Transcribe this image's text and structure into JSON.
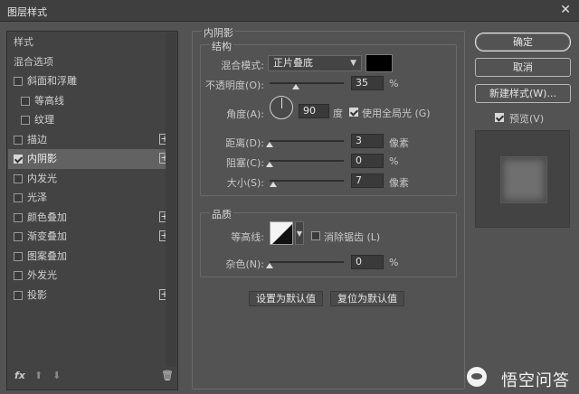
{
  "window": {
    "title": "图层样式",
    "close_glyph": "✕"
  },
  "left_panel": {
    "items": [
      {
        "label": "样式",
        "type": "header"
      },
      {
        "label": "混合选项",
        "type": "header"
      },
      {
        "label": "斜面和浮雕",
        "checked": false
      },
      {
        "label": "等高线",
        "checked": false,
        "sub": true
      },
      {
        "label": "纹理",
        "checked": false,
        "sub": true
      },
      {
        "label": "描边",
        "checked": false,
        "plus": "+"
      },
      {
        "label": "内阴影",
        "checked": true,
        "plus": "+",
        "selected": true
      },
      {
        "label": "内发光",
        "checked": false
      },
      {
        "label": "光泽",
        "checked": false
      },
      {
        "label": "颜色叠加",
        "checked": false,
        "plus": "+"
      },
      {
        "label": "渐变叠加",
        "checked": false,
        "plus": "+"
      },
      {
        "label": "图案叠加",
        "checked": false
      },
      {
        "label": "外发光",
        "checked": false
      },
      {
        "label": "投影",
        "checked": false,
        "plus": "+"
      }
    ],
    "footer": {
      "fx": "fx",
      "up": "⬆",
      "down": "⬇",
      "trash": "🗑"
    }
  },
  "inner_shadow": {
    "section_title": "内阴影",
    "structure": {
      "title": "结构",
      "blend_mode_label": "混合模式:",
      "blend_mode_value": "正片叠底",
      "shadow_color": "#000000",
      "opacity_label": "不透明度(O):",
      "opacity_value": "35",
      "opacity_unit": "%",
      "opacity_fraction": 0.35,
      "angle_label": "角度(A):",
      "angle_value": "90",
      "angle_unit": "度",
      "global_light_label": "使用全局光 (G)",
      "global_light_checked": true,
      "distance_label": "距离(D):",
      "distance_value": "3",
      "distance_unit": "像素",
      "choke_label": "阻塞(C):",
      "choke_value": "0",
      "choke_unit": "%",
      "size_label": "大小(S):",
      "size_value": "7",
      "size_unit": "像素"
    },
    "quality": {
      "title": "品质",
      "contour_label": "等高线:",
      "antialias_label": "消除锯齿 (L)",
      "antialias_checked": false,
      "noise_label": "杂色(N):",
      "noise_value": "0",
      "noise_unit": "%"
    },
    "set_default_label": "设置为默认值",
    "reset_default_label": "复位为默认值"
  },
  "right_panel": {
    "ok_label": "确定",
    "cancel_label": "取消",
    "new_style_label": "新建样式(W)...",
    "preview_label": "预览(V)",
    "preview_checked": true
  },
  "watermark": {
    "text": "悟空问答"
  }
}
